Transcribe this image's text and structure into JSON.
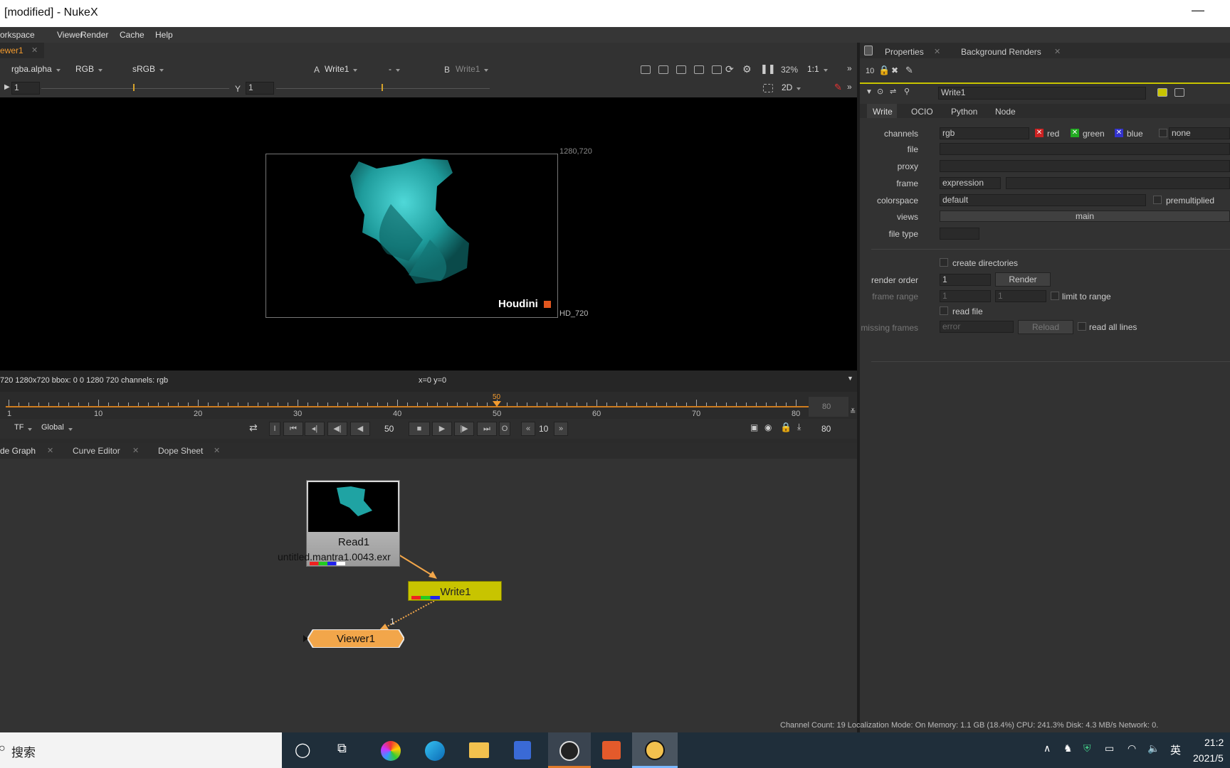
{
  "window": {
    "title": "[modified] - NukeX",
    "minimize": "—"
  },
  "menu": [
    "orkspace",
    "Viewer",
    "Render",
    "Cache",
    "Help"
  ],
  "viewer_panel": {
    "tab": "ewer1",
    "channels": "rgba.alpha",
    "rgb": "RGB",
    "lut": "sRGB",
    "input_a_label": "A",
    "input_a": "Write1",
    "wipe": "-",
    "input_b_label": "B",
    "input_b": "Write1",
    "zoom": "32%",
    "ratio": "1:1",
    "gain_value": "1",
    "gamma_label": "Y",
    "gamma_value": "1",
    "view_mode": "2D",
    "format_tr": "1280,720",
    "format_br": "HD_720",
    "watermark": "Houdini",
    "info_left": "720 1280x720  bbox: 0 0 1280 720 channels: rgb",
    "info_coords": "x=0 y=0"
  },
  "timeline": {
    "ticks": [
      {
        "label": "1",
        "frame": 1
      },
      {
        "label": "10",
        "frame": 10
      },
      {
        "label": "20",
        "frame": 20
      },
      {
        "label": "30",
        "frame": 30
      },
      {
        "label": "40",
        "frame": 40
      },
      {
        "label": "50",
        "frame": 50
      },
      {
        "label": "60",
        "frame": 60
      },
      {
        "label": "70",
        "frame": 70
      },
      {
        "label": "80",
        "frame": 80
      }
    ],
    "current": "50",
    "end_frame": "80",
    "tf": "TF",
    "scope": "Global",
    "frame_field": "50",
    "step": "10",
    "out_field": "80"
  },
  "graph_tabs": [
    {
      "label": "de Graph",
      "close": "✕"
    },
    {
      "label": "Curve Editor",
      "close": "✕"
    },
    {
      "label": "Dope Sheet",
      "close": "✕"
    }
  ],
  "nodes": {
    "read": {
      "label": "Read1",
      "file": "untitled.mantra1.0043.exr"
    },
    "write": {
      "label": "Write1"
    },
    "viewer": {
      "label": "Viewer1",
      "input": "1"
    }
  },
  "props": {
    "tabs": [
      {
        "label": "Properties",
        "close": "✕"
      },
      {
        "label": "Background Renders",
        "close": "✕"
      }
    ],
    "max_panels": "10",
    "node_name": "Write1",
    "sub_tabs": [
      "Write",
      "OCIO",
      "Python",
      "Node"
    ],
    "channels_label": "channels",
    "channels_value": "rgb",
    "ch_red": "red",
    "ch_green": "green",
    "ch_blue": "blue",
    "ch_none": "none",
    "file_label": "file",
    "proxy_label": "proxy",
    "frame_label": "frame",
    "frame_value": "expression",
    "colorspace_label": "colorspace",
    "colorspace_value": "default",
    "premult_label": "premultiplied",
    "views_label": "views",
    "views_value": "main",
    "filetype_label": "file type",
    "create_dirs_label": "create directories",
    "render_order_label": "render order",
    "render_order_value": "1",
    "render_button": "Render",
    "frame_range_label": "frame range",
    "frame_range_start": "1",
    "frame_range_end": "1",
    "limit_label": "limit to range",
    "read_file_label": "read file",
    "missing_frames_label": "missing frames",
    "missing_frames_value": "error",
    "reload_button": "Reload",
    "read_all_lines_label": "read all lines"
  },
  "status": "Channel Count: 19  Localization Mode: On  Memory: 1.1 GB (18.4%)  CPU: 241.3%  Disk: 4.3 MB/s  Network: 0.",
  "taskbar": {
    "search": "搜索",
    "time": "21:2",
    "date": "2021/5",
    "ime": "英"
  },
  "colors": {
    "accent": "#f29a2e",
    "write_node": "#c8c400",
    "viewer_node": "#f2a64a",
    "teal": "#2fb3b3"
  }
}
